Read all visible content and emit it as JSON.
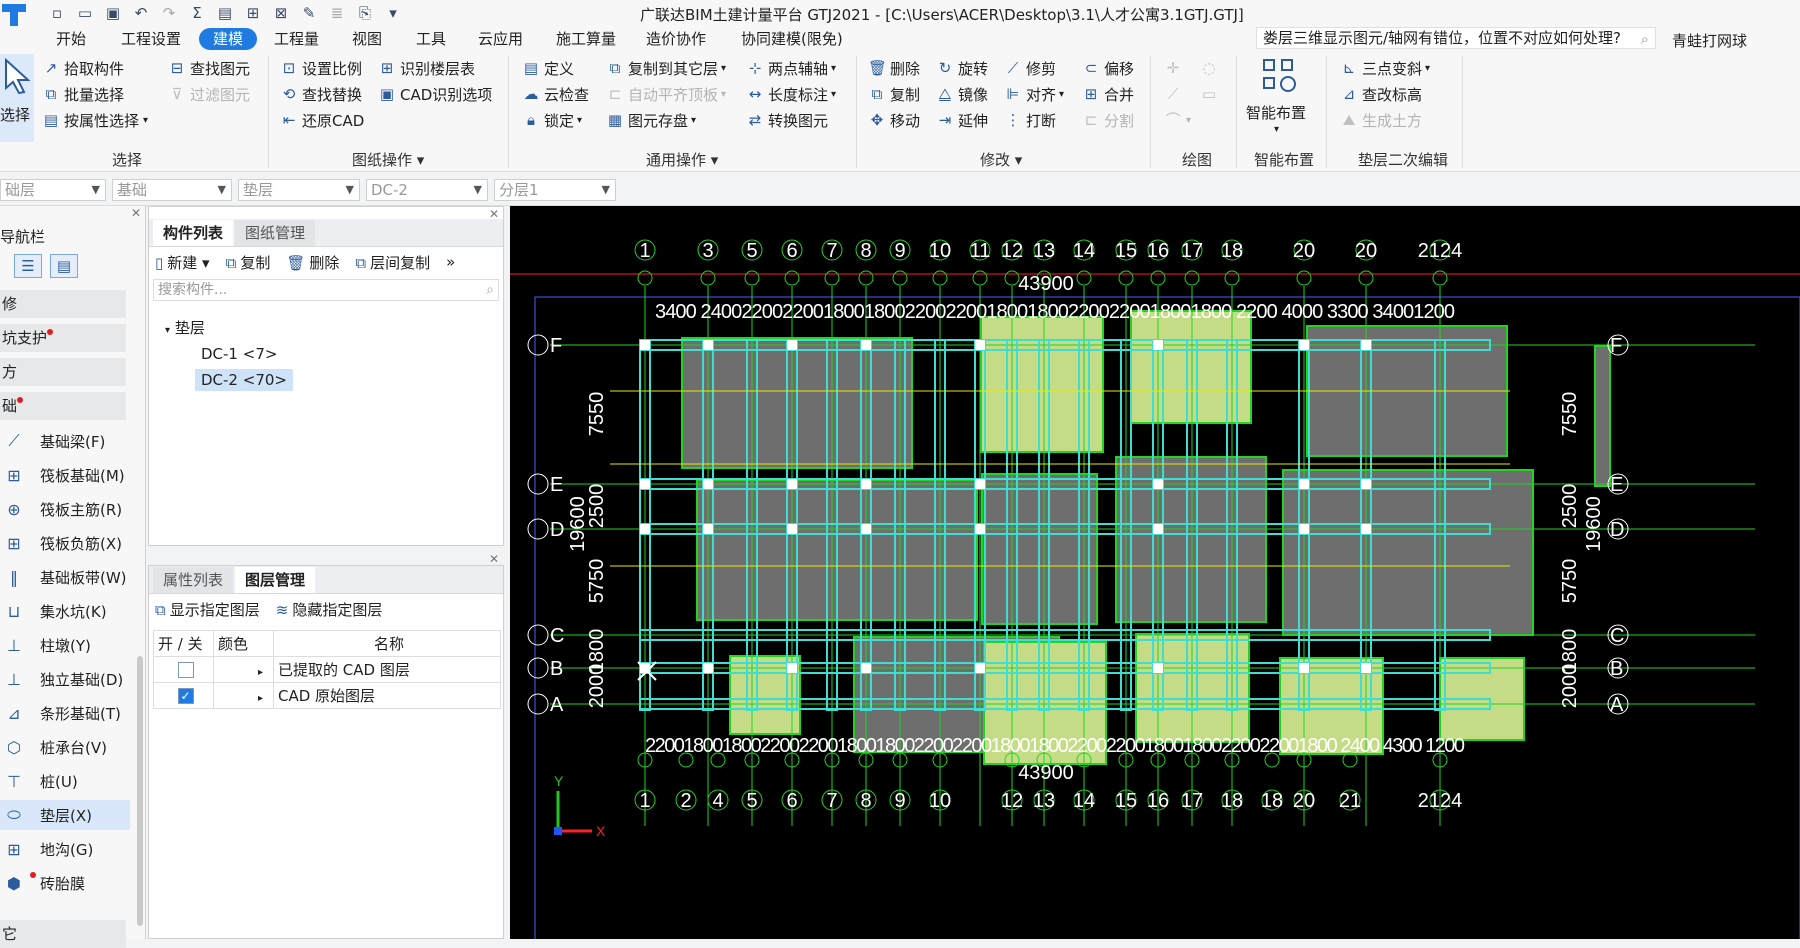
{
  "window": {
    "title": "广联达BIM土建计量平台 GTJ2021 - [C:\\Users\\ACER\\Desktop\\3.1\\人才公寓3.1GTJ.GTJ]"
  },
  "menu": {
    "tabs": [
      "开始",
      "工程设置",
      "建模",
      "工程量",
      "视图",
      "工具",
      "云应用",
      "施工算量",
      "造价协作",
      "协同建模(限免)"
    ],
    "active": "建模"
  },
  "help": {
    "search_value": "娄层三维显示图元/轴网有错位，位置不对应如何处理?",
    "forum_label": "青蛙打网球"
  },
  "ribbon": {
    "select": {
      "big_label": "选择",
      "items": [
        "拾取构件",
        "批量选择",
        "按属性选择"
      ],
      "more": [
        "查找图元",
        "过滤图元"
      ],
      "group_label": "选择"
    },
    "drawing_ops": {
      "items": [
        "设置比例",
        "识别楼层表",
        "查找替换",
        "CAD识别选项",
        "还原CAD"
      ],
      "group_label": "图纸操作"
    },
    "general_ops": {
      "items": [
        "定义",
        "复制到其它层",
        "两点辅轴",
        "云检查",
        "自动平齐顶板",
        "长度标注",
        "锁定",
        "图元存盘",
        "转换图元"
      ],
      "group_label": "通用操作"
    },
    "modify": {
      "items": [
        "删除",
        "旋转",
        "修剪",
        "偏移",
        "复制",
        "镜像",
        "对齐",
        "合并",
        "移动",
        "延伸",
        "打断",
        "分割"
      ],
      "group_label": "修改"
    },
    "draw": {
      "group_label": "绘图"
    },
    "smart_layout": {
      "big_label": "智能布置",
      "group_label": "智能布置"
    },
    "pad_edit": {
      "items": [
        "三点变斜",
        "查改标高",
        "生成土方"
      ],
      "group_label": "垫层二次编辑"
    }
  },
  "selectors": [
    {
      "value": "础层"
    },
    {
      "value": "基础"
    },
    {
      "value": "垫层"
    },
    {
      "value": "DC-2"
    },
    {
      "value": "分层1"
    }
  ],
  "nav": {
    "header": "导航栏",
    "categories": [
      "修",
      "坑支护",
      "方",
      "础"
    ],
    "items": [
      "基础梁(F)",
      "筏板基础(M)",
      "筏板主筋(R)",
      "筏板负筋(X)",
      "基础板带(W)",
      "集水坑(K)",
      "柱墩(Y)",
      "独立基础(D)",
      "条形基础(T)",
      "桩承台(V)",
      "桩(U)",
      "垫层(X)",
      "地沟(G)",
      "砖胎膜"
    ],
    "selected": "垫层(X)",
    "last_cat": "它"
  },
  "component_panel": {
    "tabs": [
      "构件列表",
      "图纸管理"
    ],
    "toolbar": [
      "新建",
      "复制",
      "删除",
      "层间复制"
    ],
    "search_placeholder": "搜索构件...",
    "tree_root": "垫层",
    "tree_items": [
      "DC-1 <7>",
      "DC-2 <70>"
    ]
  },
  "layer_panel": {
    "tabs": [
      "属性列表",
      "图层管理"
    ],
    "toolbar": [
      "显示指定图层",
      "隐藏指定图层"
    ],
    "headers": [
      "开 / 关",
      "颜色",
      "名称"
    ],
    "rows": [
      {
        "name": "已提取的 CAD 图层",
        "checked": false
      },
      {
        "name": "CAD 原始图层",
        "checked": true
      }
    ]
  },
  "cad": {
    "top_axis_labels": [
      "1",
      "3",
      "5",
      "6",
      "7",
      "8",
      "9",
      "10",
      "11",
      "12",
      "13",
      "14",
      "15",
      "16",
      "17",
      "18",
      "20",
      "20",
      "2124"
    ],
    "bottom_axis_labels": [
      "1",
      "2",
      "4",
      "5",
      "6",
      "7",
      "8",
      "9",
      "10",
      "12",
      "13",
      "14",
      "15",
      "16",
      "17",
      "18",
      "18",
      "20",
      "21",
      "2124"
    ],
    "row_labels": [
      "F",
      "E",
      "D",
      "C",
      "B",
      "A"
    ],
    "total_width": "43900",
    "top_dims": "3400  2400220022001800180022002200180018002200220018001800 2200 4000  3300  34001200",
    "bottom_dims": "220018001800220022001800180022002200180018002200220018001800220022001800 2400  4300 1200",
    "left_dims": [
      "7550",
      "2500",
      "5750",
      "1800",
      "2000"
    ],
    "left_total": "19600",
    "right_dims": [
      "7550",
      "2500",
      "5750",
      "1800",
      "2000"
    ],
    "right_total": "19600",
    "colors": {
      "axis": "#21d421",
      "pad": "#6e6e6e",
      "pad_light": "#c5dc86",
      "beam": "#3fdcd0",
      "grid_yellow": "#e8e800",
      "border": "#ff2020"
    }
  }
}
